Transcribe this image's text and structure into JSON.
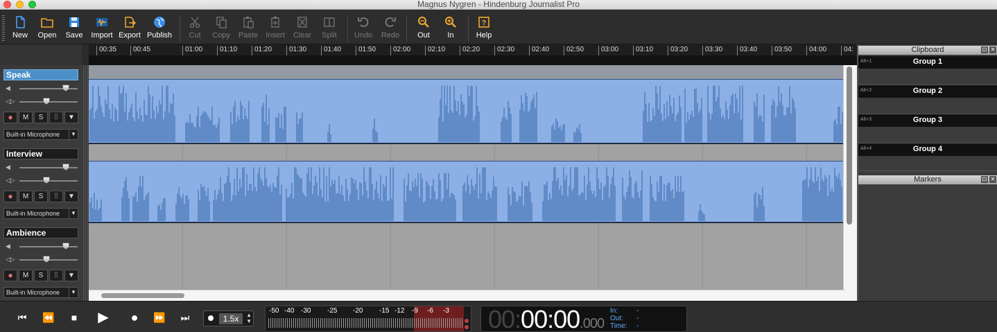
{
  "window": {
    "title": "Magnus Nygren - Hindenburg Journalist Pro"
  },
  "toolbar": {
    "new": "New",
    "open": "Open",
    "save": "Save",
    "import": "Import",
    "export": "Export",
    "publish": "Publish",
    "cut": "Cut",
    "copy": "Copy",
    "paste": "Paste",
    "insert": "Insert",
    "clear": "Clear",
    "split": "Split",
    "undo": "Undo",
    "redo": "Redo",
    "out": "Out",
    "in": "In",
    "help": "Help"
  },
  "ruler": {
    "ticks": [
      "00:35",
      "00:45",
      "01:00",
      "01:10",
      "01:20",
      "01:30",
      "01:40",
      "01:50",
      "02:00",
      "02:10",
      "02:20",
      "02:30",
      "02:40",
      "02:50",
      "03:00",
      "03:10",
      "03:20",
      "03:30",
      "03:40",
      "03:50",
      "04:00",
      "04:"
    ]
  },
  "tracks": [
    {
      "name": "Speak",
      "input": "Built-in Microphone",
      "m": "M",
      "s": "S",
      "selected": true
    },
    {
      "name": "Interview",
      "input": "Built-in Microphone",
      "m": "M",
      "s": "S"
    },
    {
      "name": "Ambience",
      "input": "Built-in Microphone",
      "m": "M",
      "s": "S"
    }
  ],
  "clipboard": {
    "title": "Clipboard",
    "groups": [
      {
        "key": "Alt+1",
        "name": "Group 1"
      },
      {
        "key": "Alt+2",
        "name": "Group 2"
      },
      {
        "key": "Alt+3",
        "name": "Group 3"
      },
      {
        "key": "Alt+4",
        "name": "Group 4"
      }
    ]
  },
  "markers": {
    "title": "Markers"
  },
  "transport": {
    "speed": "1.5x",
    "meter_scale": [
      "-50",
      "-40",
      "-30",
      "-25",
      "-20",
      "-15",
      "-12",
      "-9",
      "-6",
      "-3"
    ],
    "clock_dim": "00:",
    "clock_main": "00:00",
    "clock_ms": ".000",
    "in_label": "In:",
    "out_label": "Out:",
    "time_label": "Time:",
    "in_value": "-",
    "out_value": "-",
    "time_value": "-"
  },
  "colors": {
    "clip_fill": "#8cb0e6",
    "wave": "#3466a8",
    "accent": "#4a8fc8"
  }
}
